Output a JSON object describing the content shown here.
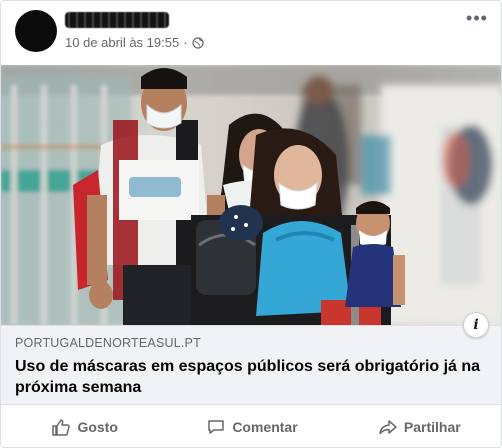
{
  "post": {
    "author_name": "redacted",
    "timestamp": "10 de abril às 19:55",
    "separator": "·",
    "more_label": "•••"
  },
  "link_preview": {
    "domain": "PORTUGALDENORTEASUL.PT",
    "headline": "Uso de máscaras em espaços públicos será obrigatório já na próxima semana",
    "info_label": "i"
  },
  "actions": {
    "like_label": "Gosto",
    "comment_label": "Comentar",
    "share_label": "Partilhar"
  },
  "colors": {
    "card_border": "#dddfe2",
    "preview_bg": "#f0f2f5",
    "muted_text": "#65676b"
  },
  "icons": {
    "privacy": "globe-icon",
    "more": "more-horizontal-icon",
    "like": "thumbs-up-icon",
    "comment": "comment-bubble-icon",
    "share": "share-arrow-icon"
  }
}
